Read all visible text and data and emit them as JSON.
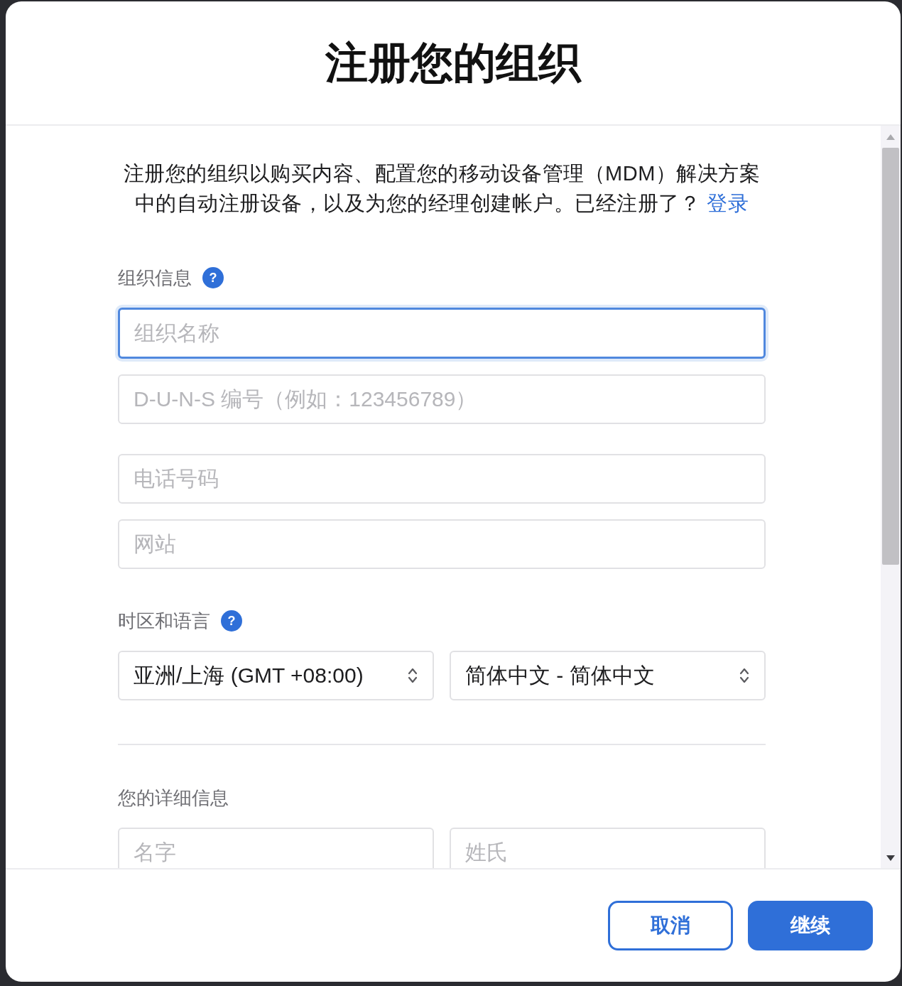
{
  "dialog": {
    "title": "注册您的组织"
  },
  "intro": {
    "text": "注册您的组织以购买内容、配置您的移动设备管理（MDM）解决方案中的自动注册设备，以及为您的经理创建帐户。已经注册了？",
    "link": "登录"
  },
  "sections": [
    {
      "label": "组织信息",
      "help_button": "?",
      "divider_before": false,
      "groups": [
        [
          [
            {
              "kind": "input",
              "placeholder": "组织名称",
              "focused": true
            }
          ],
          [
            {
              "kind": "input",
              "placeholder": "D-U-N-S 编号（例如：123456789）",
              "focused": false
            }
          ]
        ],
        [
          [
            {
              "kind": "input",
              "placeholder": "电话号码",
              "focused": false
            }
          ],
          [
            {
              "kind": "input",
              "placeholder": "网站",
              "focused": false
            }
          ]
        ]
      ]
    },
    {
      "label": "时区和语言",
      "help_button": "?",
      "divider_before": false,
      "groups": [
        [
          [
            {
              "kind": "select",
              "value": "亚洲/上海 (GMT +08:00)"
            },
            {
              "kind": "select",
              "value": "简体中文 - 简体中文"
            }
          ]
        ]
      ]
    },
    {
      "label": "您的详细信息",
      "divider_before": true,
      "groups": [
        [
          [
            {
              "kind": "input",
              "placeholder": "名字",
              "focused": false
            },
            {
              "kind": "input",
              "placeholder": "姓氏",
              "focused": false
            }
          ]
        ]
      ]
    }
  ],
  "footer": {
    "buttons": [
      {
        "kind": "secondary",
        "label": "取消"
      },
      {
        "kind": "primary",
        "label": "继续"
      }
    ]
  }
}
